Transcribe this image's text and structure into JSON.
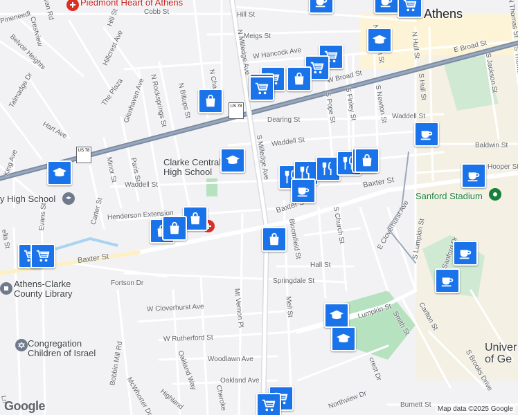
{
  "map": {
    "city_label": "Athens",
    "attribution": "Map data ©2025 Google",
    "logo": "Google",
    "colors": {
      "route": "#7a8ba3",
      "marker": "#1a73e8",
      "park": "#b7e2c0",
      "campus": "#fdf4d8"
    }
  },
  "streets": {
    "cobb": "Cobb St",
    "hill": "Hill St",
    "meigs": "Meigs St",
    "hancock": "W Hancock Ave",
    "broad_e": "E Broad St",
    "broad_w": "W Broad St",
    "dearing": "Dearing St",
    "waddell_w": "Waddell St",
    "waddell_e": "Waddell St",
    "waddell_c": "Waddell St",
    "baxter_w": "Baxter St",
    "baxter_c": "Baxter St",
    "baxter_e": "Baxter St",
    "henderson": "Henderson Extension",
    "hall": "Hall St",
    "springdale": "Springdale St",
    "fortson": "Fortson Dr",
    "cloverhurst_w": "W Cloverhurst Ave",
    "cloverhurst_e": "E Cloverhurst Ave",
    "rutherford": "W Rutherford St",
    "woodlawn": "Woodlawn Ave",
    "oakland": "Oakland Ave",
    "lumpkin_st": "Lumpkin St",
    "milledge_n": "N Milledge Ave",
    "milledge_s": "S Milledge Ave",
    "pope": "S Pope St",
    "finley": "S Finley St",
    "newton_n": "N Newton St",
    "newton_s": "S Newton St",
    "hull_n": "N Hull St",
    "hull_s": "S Hull St",
    "lumpkin_s": "S Lumpkin St",
    "jackson": "S Jackson St",
    "thomas_n": "N Thomas St",
    "thomas_s": "S Thomas St",
    "church": "S Church St",
    "bloomfield": "Bloomfield St",
    "mell": "Mell St",
    "mount_vernon": "Mt Vernon Pl",
    "billups": "N Billups St",
    "rocksprings": "N Rocksprings St",
    "glenhaven": "Glenhaven Ave",
    "plaza": "The Plaza",
    "hillcrest": "Hillcrest Ave",
    "belvoir": "Belvoir Heights",
    "talmadge": "Talmadge Dr",
    "hart": "Hart Ave",
    "paris": "Paris St",
    "minor": "Minor St",
    "carter": "Carter St",
    "evans": "Evans St",
    "king": "King Ave",
    "bobbin": "Bobbin Mill Rd",
    "mcwhorter": "McWhorter Dr",
    "oakland_way": "Oakland Way",
    "highland": "Highland",
    "cherokee": "Cheroke",
    "carlton": "Carlton St",
    "smith": "Smith St",
    "baldwin": "Baldwin St",
    "hooper": "Hooper St",
    "northview": "Northview Dr",
    "burnett": "Burnett St",
    "brooks": "S Brooks Drive",
    "crest": "crest Dr",
    "sanford": "Sanford Dr",
    "pineneedle": "Pineneedl",
    "crestview": "Crestview",
    "ivan": "van Rd",
    "clln": "N Chase St",
    "milledge_n2": "N Milledge",
    "loftin": "Ln",
    "elia": "ella St"
  },
  "places": {
    "piedmont": "Piedmont Heart of Athens",
    "clarke_central": "Clarke Central High School",
    "cedar_school": "y High School",
    "library": "Athens-Clarke County Library",
    "congregation": "Congregation Children of Israel",
    "sanford": "Sanford Stadium",
    "uga": "Univer of Ge"
  },
  "route_badges": {
    "us78_a": "US 78",
    "us78_b": "US 78"
  },
  "markers": [
    {
      "type": "cafe-icon"
    },
    {
      "type": "cafe-icon"
    },
    {
      "type": "shopping-cart-icon"
    },
    {
      "type": "school-icon"
    },
    {
      "type": "shopping-cart-icon"
    },
    {
      "type": "shopping-cart-icon"
    },
    {
      "type": "shopping-cart-icon"
    },
    {
      "type": "shopping-cart-icon"
    },
    {
      "type": "shopping-bag-icon"
    },
    {
      "type": "shopping-cart-icon"
    },
    {
      "type": "shopping-bag-icon"
    },
    {
      "type": "cafe-icon"
    },
    {
      "type": "school-icon"
    },
    {
      "type": "school-icon"
    },
    {
      "type": "restaurant-icon"
    },
    {
      "type": "restaurant-icon"
    },
    {
      "type": "restaurant-icon"
    },
    {
      "type": "restaurant-icon"
    },
    {
      "type": "restaurant-icon"
    },
    {
      "type": "shopping-bag-icon"
    },
    {
      "type": "cafe-icon"
    },
    {
      "type": "cafe-icon"
    },
    {
      "type": "shopping-bag-icon"
    },
    {
      "type": "shopping-bag-icon"
    },
    {
      "type": "shopping-bag-icon"
    },
    {
      "type": "shopping-bag-icon"
    },
    {
      "type": "shopping-cart-icon"
    },
    {
      "type": "shopping-cart-icon"
    },
    {
      "type": "cafe-icon"
    },
    {
      "type": "cafe-icon"
    },
    {
      "type": "school-icon"
    },
    {
      "type": "school-icon"
    },
    {
      "type": "shopping-cart-icon"
    },
    {
      "type": "shopping-cart-icon"
    }
  ]
}
